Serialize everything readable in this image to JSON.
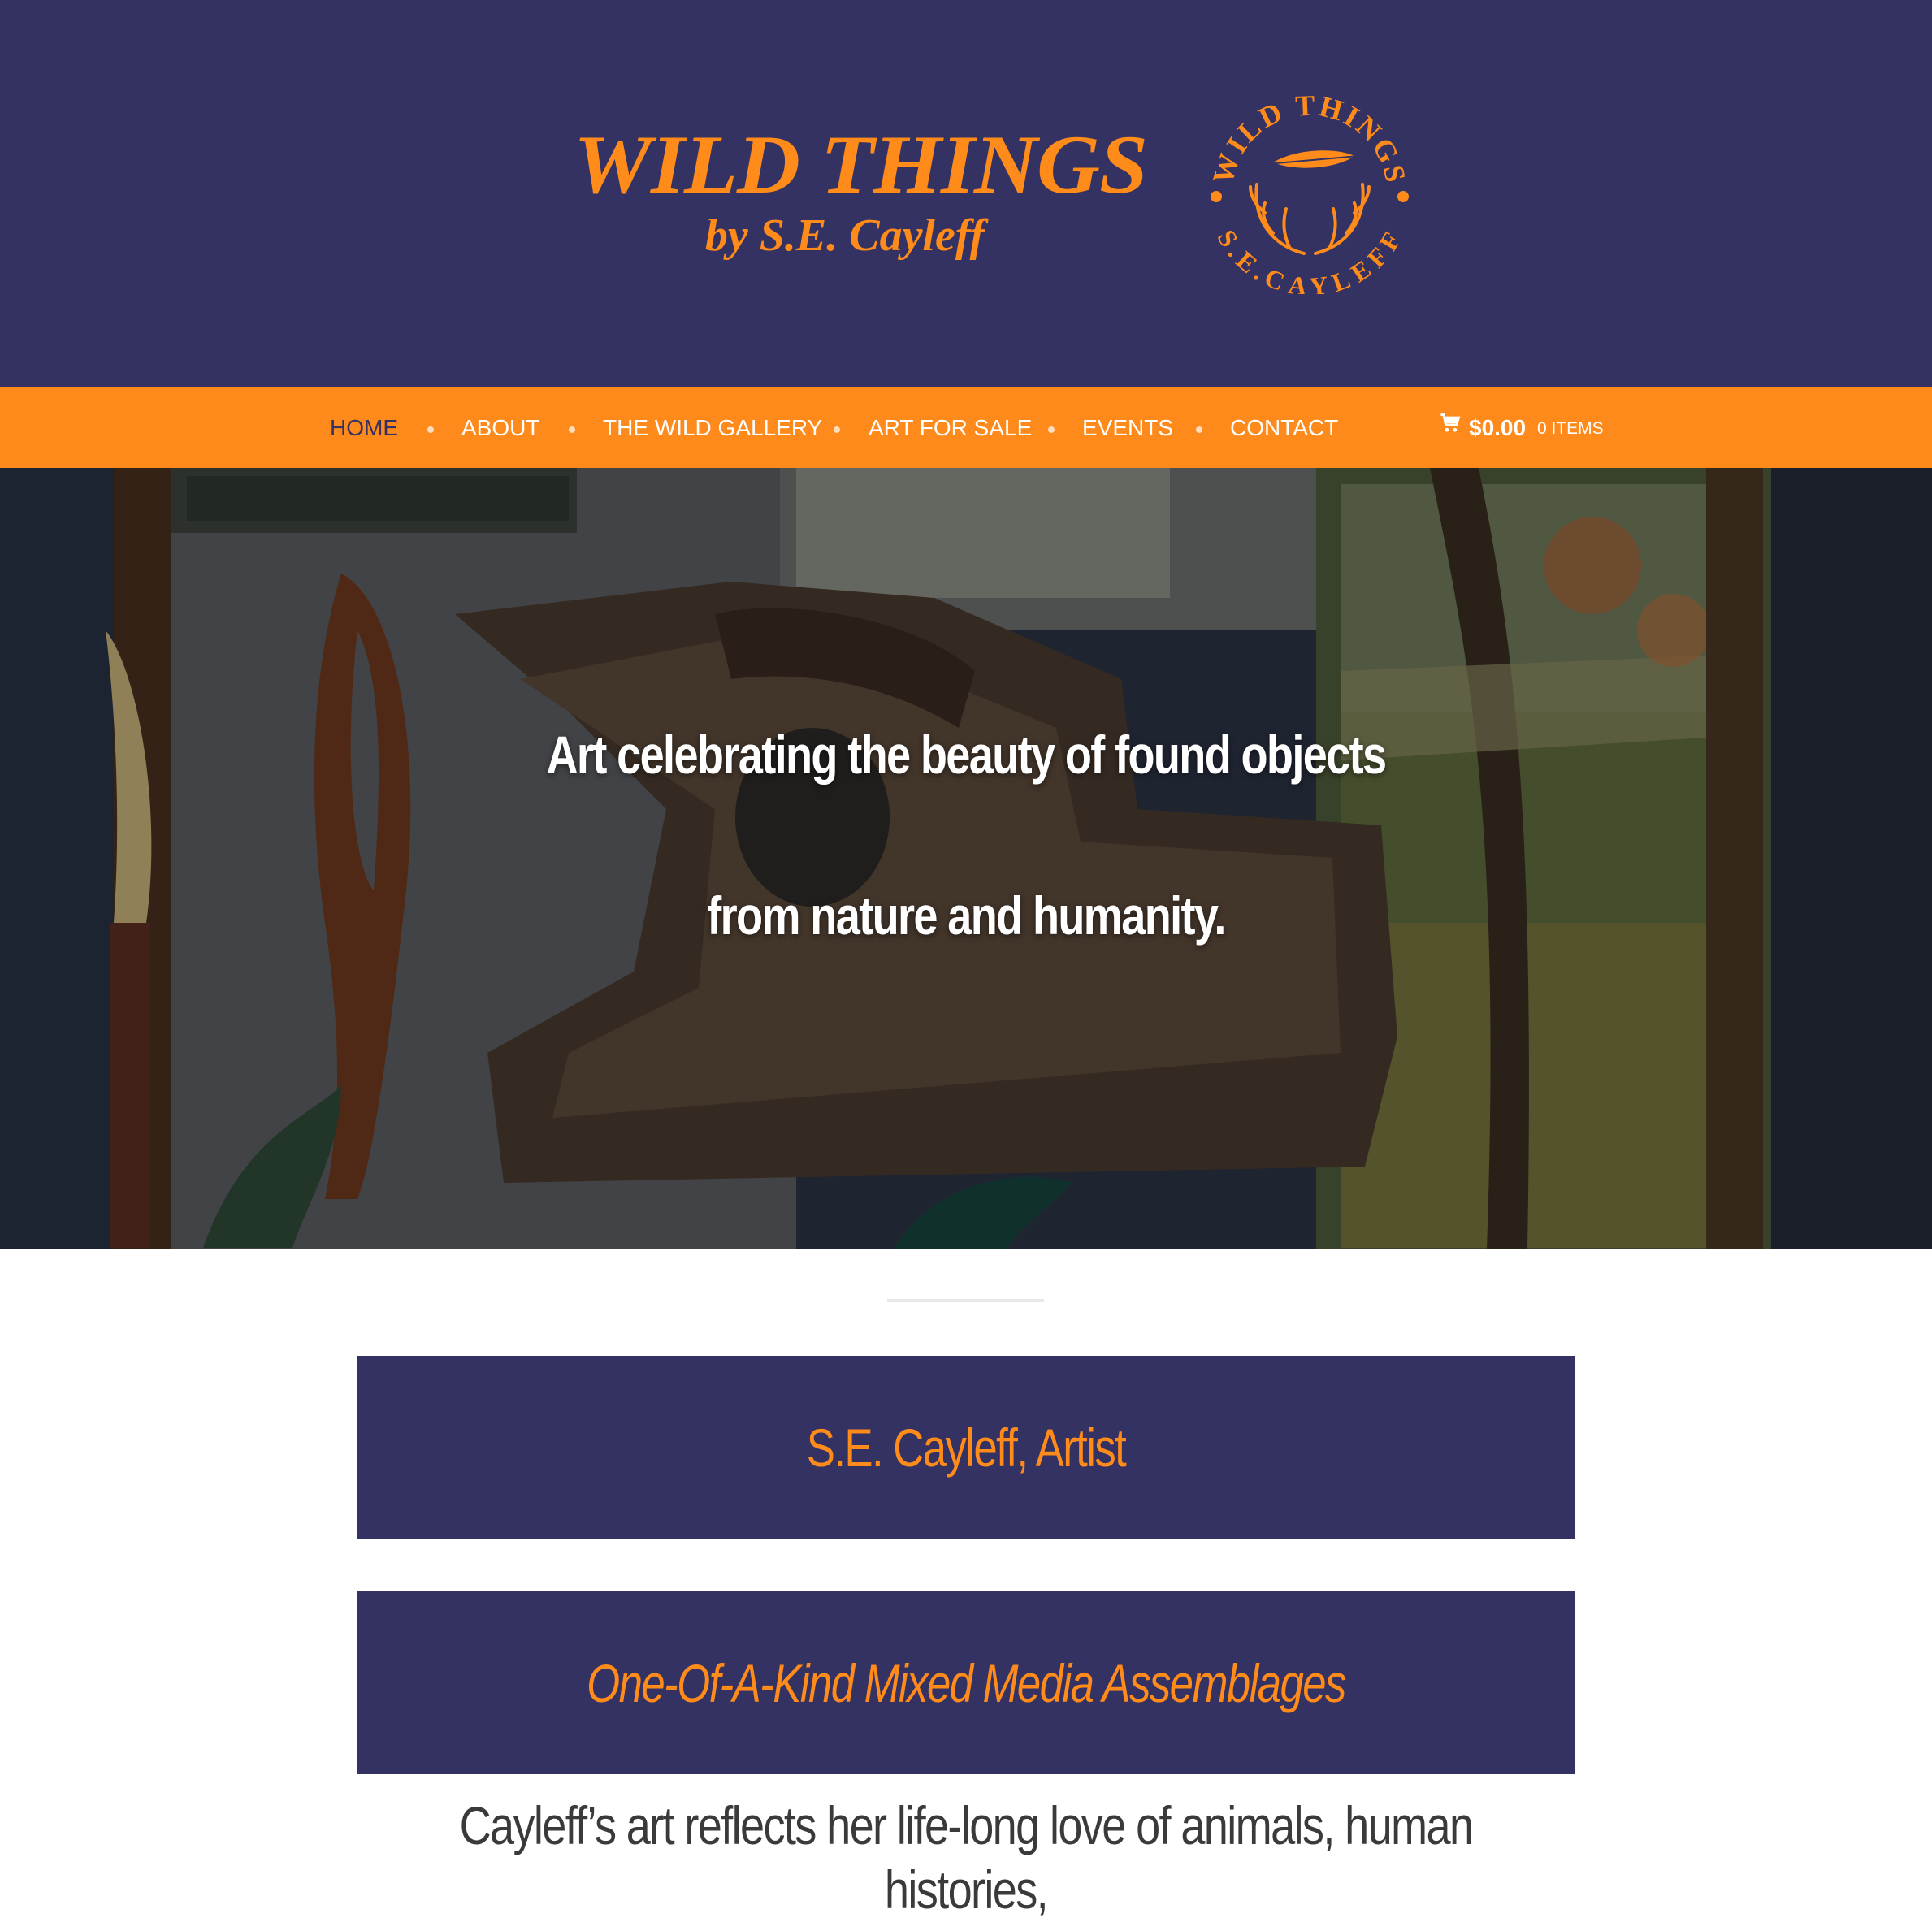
{
  "site": {
    "title": "WILD THINGS",
    "subtitle": "by S.E. Cayleff",
    "seal_top_text": "WILD THINGS",
    "seal_bottom_text": "S.E.CAYLEFF",
    "seal_icons": [
      "feather-icon",
      "antlers-icon"
    ]
  },
  "nav": {
    "items": [
      {
        "label": "HOME",
        "active": true
      },
      {
        "label": "ABOUT",
        "active": false
      },
      {
        "label": "THE WILD GALLERY",
        "active": false
      },
      {
        "label": "ART FOR SALE",
        "active": false
      },
      {
        "label": "EVENTS",
        "active": false
      },
      {
        "label": "CONTACT",
        "active": false
      }
    ],
    "cart": {
      "icon": "cart-icon",
      "total": "$0.00",
      "count": "0 ITEMS"
    }
  },
  "hero": {
    "line1": "Art celebrating the beauty of found objects",
    "line2": "from nature and humanity."
  },
  "banners": {
    "artist": "S.E. Cayleff, Artist",
    "tagline": "One-Of-A-Kind Mixed Media Assemblages"
  },
  "intro": {
    "text": "Cayleff’s art reflects her life-long love of animals, human histories,"
  },
  "colors": {
    "navy": "#343263",
    "orange": "#ff8b1a",
    "white": "#ffffff"
  }
}
